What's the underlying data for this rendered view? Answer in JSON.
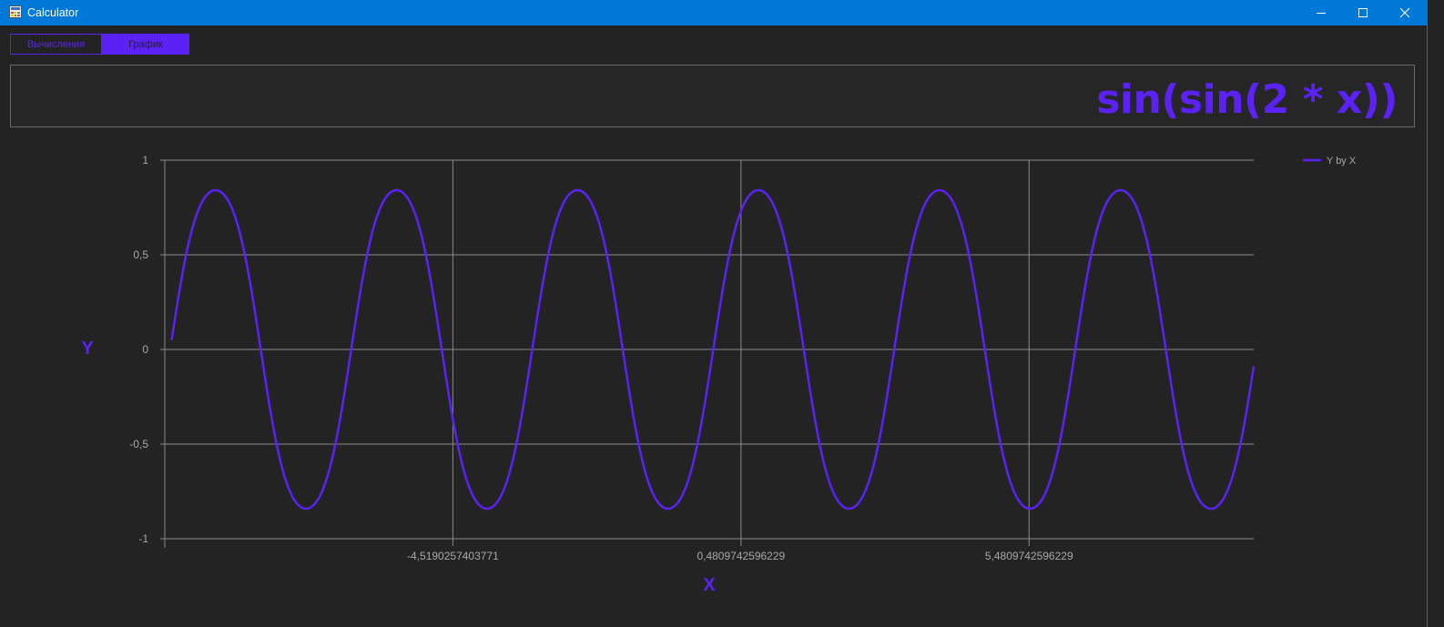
{
  "window": {
    "title": "Calculator",
    "icons": {
      "app": "calculator-app-icon",
      "minimize": "minimize-icon",
      "maximize": "maximize-icon",
      "close": "close-icon"
    }
  },
  "colors": {
    "titlebar": "#0078d7",
    "accent": "#5b21f5",
    "background": "#232323",
    "grid": "#8a8a8a",
    "tick_text": "#a8a8a8"
  },
  "tabs": [
    {
      "label": "Вычисления",
      "active": false
    },
    {
      "label": "График",
      "active": true
    }
  ],
  "display": {
    "expression": "sin(sin(2 * x))"
  },
  "chart_data": {
    "type": "line",
    "function": "sin(sin(2 * x))",
    "xlabel": "X",
    "ylabel": "Y",
    "ylim": [
      -1,
      1
    ],
    "xlim": [
      -9.519,
      9.38
    ],
    "x_start": -9.4,
    "x_end": 9.38,
    "y_ticks": [
      1,
      0.5,
      0,
      -0.5,
      -1
    ],
    "y_tick_labels": [
      "1",
      "0,5",
      "0",
      "-0,5",
      "-1"
    ],
    "x_ticks": [
      -4.5190257403771,
      0.4809742596229,
      5.4809742596229
    ],
    "x_tick_labels": [
      "-4,5190257403771",
      "0,4809742596229",
      "5,4809742596229"
    ],
    "grid": true,
    "legend_position": "top-right",
    "series": [
      {
        "name": "Y by X",
        "color": "#5b21f5"
      }
    ]
  }
}
